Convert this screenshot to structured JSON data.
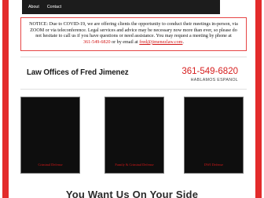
{
  "nav": {
    "items": [
      "About",
      "Contact"
    ]
  },
  "notice": {
    "line1": "NOTICE: Due to COVID-19, we are offering clients the opportunity to conduct their meetings in-person, via",
    "line2": "ZOOM or via teleconference. Legal services and advice may be necessary now more than ever, so please do",
    "line3": "not hesitate to call us if you have questions or need assistance. You may request a meeting by phone at",
    "phone": "361-549-6820",
    "or_email": "or by email at",
    "email": "fred@jimenezlaw.com",
    "end": "."
  },
  "header": {
    "firm_name": "Law Offices of Fred Jimenez",
    "phone": "361-549-6820",
    "tagline": "HABLAMOS ESPANOL"
  },
  "cards": [
    {
      "label": "Criminal Defense"
    },
    {
      "label": "Family & Criminal Defense"
    },
    {
      "label": "DWI Defense"
    }
  ],
  "headline": "You Want Us On Your Side",
  "colors": {
    "accent_red": "#e32b2b",
    "nav_bg": "#1c1c1c",
    "card_bg": "#0e0e0e"
  }
}
